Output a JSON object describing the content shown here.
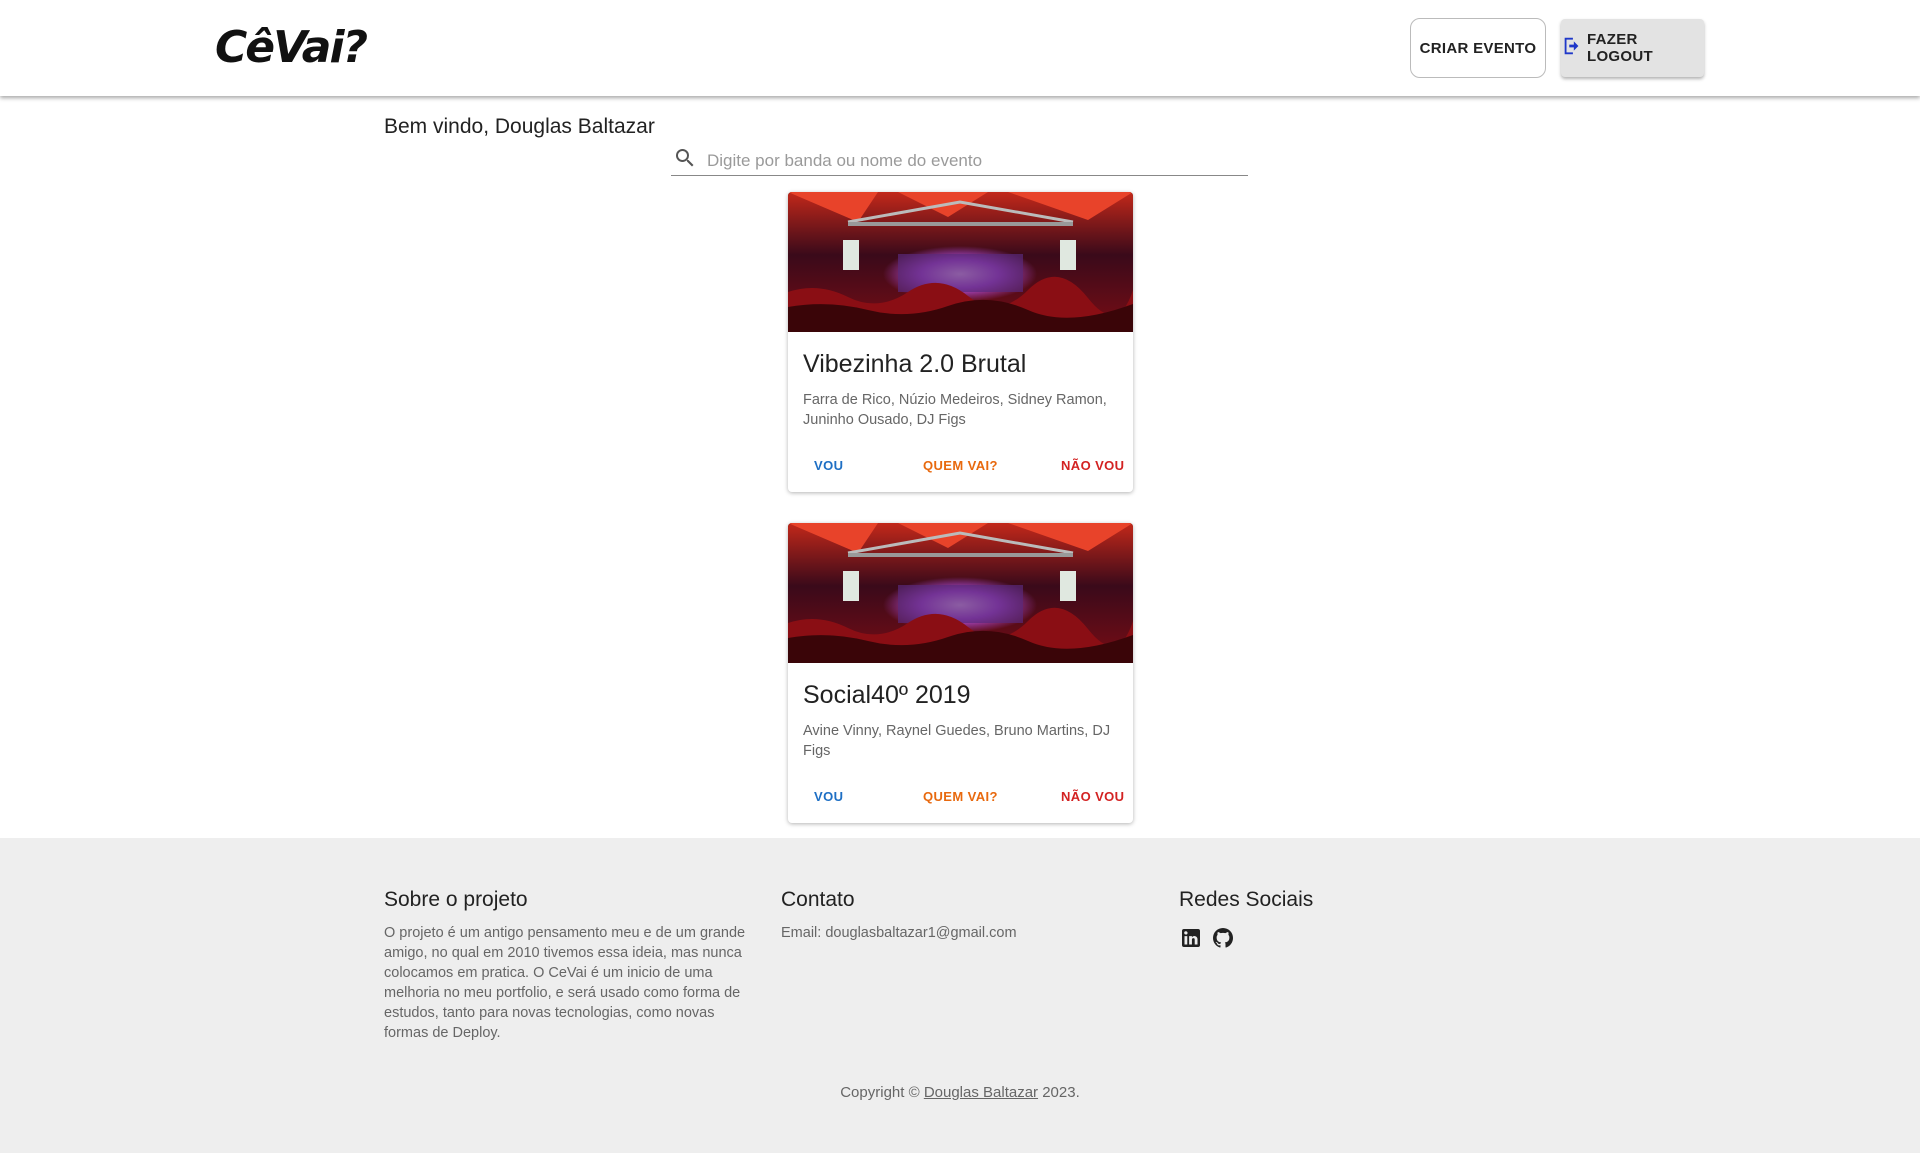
{
  "header": {
    "logo_text": "CêVai?",
    "create_event_label": "CRIAR EVENTO",
    "logout_label": "FAZER LOGOUT"
  },
  "main": {
    "welcome": "Bem vindo, Douglas Baltazar",
    "search": {
      "placeholder": "Digite por banda ou nome do evento",
      "value": ""
    },
    "events": [
      {
        "title": "Vibezinha 2.0 Brutal",
        "artists": "Farra de Rico, Núzio Medeiros, Sidney Ramon, Juninho Ousado, DJ Figs",
        "actions": {
          "going": "VOU",
          "who": "QUEM VAI?",
          "not_going": "NÃO VOU"
        }
      },
      {
        "title": "Social40º 2019",
        "artists": "Avine Vinny, Raynel Guedes, Bruno Martins, DJ Figs",
        "actions": {
          "going": "VOU",
          "who": "QUEM VAI?",
          "not_going": "NÃO VOU"
        }
      }
    ]
  },
  "footer": {
    "about_title": "Sobre o projeto",
    "about_text": "O projeto é um antigo pensamento meu e de um grande amigo, no qual em 2010 tivemos essa ideia, mas nunca colocamos em pratica. O CeVai é um inicio de uma melhoria no meu portfolio, e será usado como forma de estudos, tanto para novas tecnologias, como novas formas de Deploy.",
    "contact_title": "Contato",
    "contact_email": "Email: douglasbaltazar1@gmail.com",
    "social_title": "Redes Sociais",
    "social_icons": [
      "linkedin-icon",
      "github-icon"
    ],
    "copyright_prefix": "Copyright ©",
    "copyright_name": "Douglas Baltazar",
    "copyright_suffix": "2023."
  },
  "colors": {
    "going": "#1e6fc4",
    "who": "#e8690e",
    "not_going": "#d32222",
    "footer_bg": "#eeeeee"
  }
}
